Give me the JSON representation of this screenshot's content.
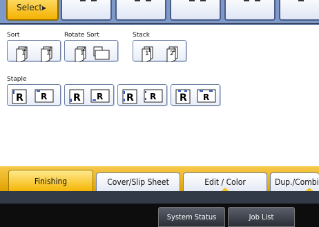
{
  "top": {
    "select_label": "Select▸"
  },
  "groups": {
    "sort": "Sort",
    "rotate_sort": "Rotate Sort",
    "stack": "Stack",
    "staple": "Staple"
  },
  "icons": {
    "page_1": "1",
    "page_2": "2",
    "staple_letter": "R"
  },
  "tabs": [
    {
      "label": "Finishing",
      "active": true
    },
    {
      "label": "Cover/Slip Sheet",
      "active": false
    },
    {
      "label": "Edit / Color",
      "active": false
    },
    {
      "label": "Dup./Combir",
      "active": false
    }
  ],
  "system": {
    "status_label": "System Status",
    "job_list_label": "Job List"
  },
  "colors": {
    "active_tab": "#f4b400",
    "panel_bg": "#ffffff",
    "accent_blue": "#2b55c7"
  }
}
